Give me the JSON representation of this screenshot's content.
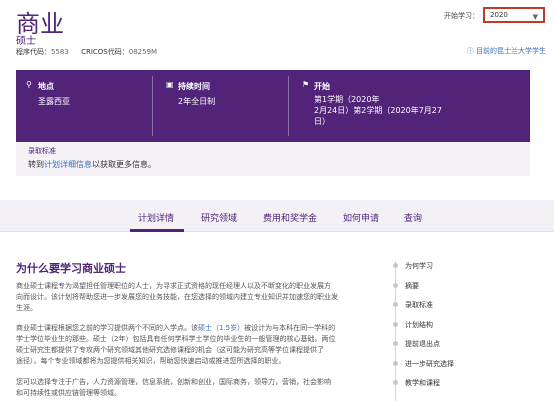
{
  "header": {
    "title": "商业",
    "subtitle": "硕士",
    "program_code_label": "程序代码：",
    "program_code": "5583",
    "cricos_label": "CRICOS代码：",
    "cricos_code": "08259M",
    "start_study_label": "开始学习：",
    "year_selected": "2020",
    "domestic_link": "目前的昆士兰大学学生"
  },
  "banner": {
    "location_label": "地点",
    "location_value": "圣露西亚",
    "duration_label": "持续时间",
    "duration_value": "2年全日制",
    "start_label": "开始",
    "start_line1": "第1学期（2020年",
    "start_line2": "2月24日）第2学期（2020年7月27",
    "start_line3": "日）"
  },
  "admission": {
    "heading": "录取标准",
    "text_before": "转到",
    "link": "计划详细信息",
    "text_after": "以获取更多信息。"
  },
  "tabs": [
    "计划详情",
    "研究领域",
    "费用和奖学金",
    "如何申请",
    "查询"
  ],
  "main": {
    "heading": "为什么要学习商业硕士",
    "para1_line1": "商业硕士课程专为渴望担任管理职位的人士，为寻求正式资格的现任经理人以及不断变化的职业发展方",
    "para1_line2": "向而设计。该计划将帮助您进一步发展您的业务技能，在您选择的领域内建立专业知识并加速您的职业发",
    "para1_line3": "生涯。",
    "para2_line1_a": "商业硕士课程根据您之前的学习提供两个不同的入学点。该",
    "para2_link": "硕士（1.5岁）",
    "para2_line1_b": "被设计为与本科在同一学科的",
    "para2_line2": "学士学位毕业生的那些。硕士（2年）包括具有任何学科学士学位的毕业生的一般管理的核心基础。两位",
    "para2_line3": "硕士研究生都提供了专攻两个研究领域其他研究选修课程的机会（这可能为研究高等学位课程提供了",
    "para2_line4": "途径）。每个专业领域都将为您提供相关知识，帮助您快速启动或推进您所选择的职业。",
    "para3_line1": "您可以选择专注于广告，人力资源管理，信息系统，创新和创业，国际商务，领导力，营销，社会影响",
    "para3_line2": "和可持续性或供应链管理等领域。"
  },
  "side_nav": [
    "为何学习",
    "摘要",
    "录取标准",
    "计划结构",
    "提前退出点",
    "进一步研究选择",
    "教学和课程"
  ],
  "colors": {
    "brand_purple": "#51247a",
    "link_blue": "#3b6fb6",
    "select_border": "#c0392b"
  }
}
